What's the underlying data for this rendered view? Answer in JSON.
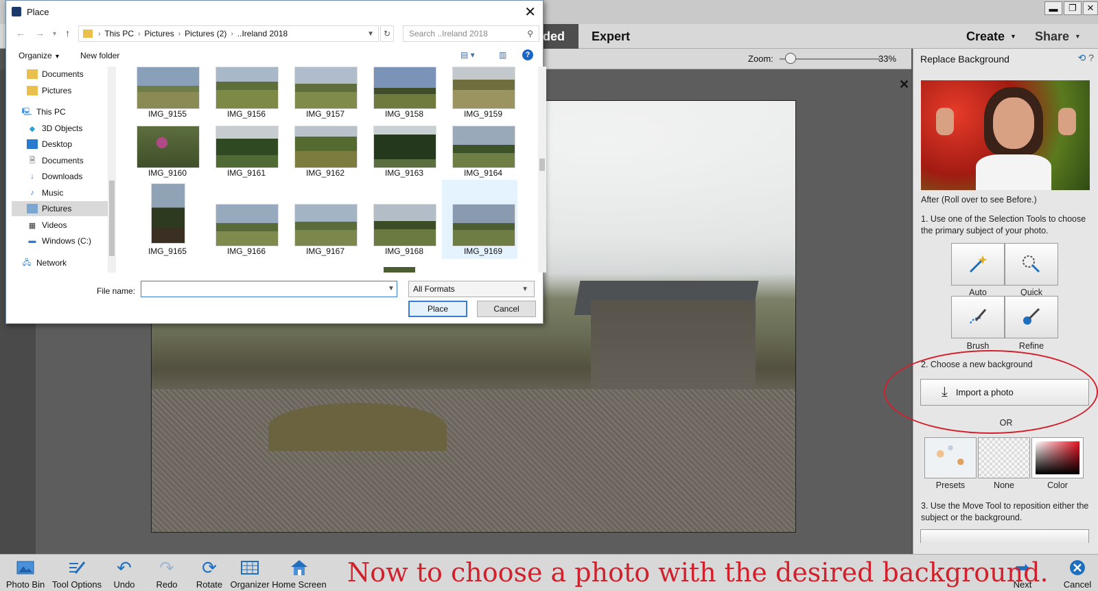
{
  "window_controls": {
    "minimize": "▬",
    "restore": "❐",
    "close": "✕"
  },
  "header": {
    "mode_guided": "ided",
    "mode_expert": "Expert",
    "create_label": "Create",
    "share_label": "Share"
  },
  "zoom": {
    "label": "Zoom:",
    "value": "33%",
    "level_fraction": 0.1
  },
  "right_panel": {
    "title": "Replace Background",
    "after_caption": "After (Roll over to see Before.)",
    "step1": "1. Use one of the Selection Tools to choose the primary subject of your photo.",
    "tools": [
      {
        "label": "Auto",
        "icon": "magic-wand-icon"
      },
      {
        "label": "Quick",
        "icon": "quick-selection-icon"
      },
      {
        "label": "Brush",
        "icon": "brush-icon"
      },
      {
        "label": "Refine",
        "icon": "refine-brush-icon"
      }
    ],
    "step2": "2. Choose a new background",
    "import_label": "Import a photo",
    "or_label": "OR",
    "backgrounds": [
      {
        "label": "Presets"
      },
      {
        "label": "None"
      },
      {
        "label": "Color"
      }
    ],
    "step3": "3. Use the Move Tool to reposition either the subject or the background."
  },
  "bottom_bar": {
    "items": [
      {
        "label": "Photo Bin",
        "icon": "photo-bin-icon"
      },
      {
        "label": "Tool Options",
        "icon": "tool-options-icon"
      },
      {
        "label": "Undo",
        "icon": "undo-icon"
      },
      {
        "label": "Redo",
        "icon": "redo-icon"
      },
      {
        "label": "Rotate",
        "icon": "rotate-icon"
      },
      {
        "label": "Organizer",
        "icon": "organizer-icon"
      },
      {
        "label": "Home Screen",
        "icon": "home-icon"
      },
      {
        "label": "Next",
        "icon": "next-arrow-icon"
      },
      {
        "label": "Cancel",
        "icon": "cancel-icon"
      }
    ]
  },
  "caption": "Now to choose a photo with the desired background.",
  "dialog": {
    "title": "Place",
    "breadcrumbs": [
      "This PC",
      "Pictures",
      "Pictures (2)",
      "..Ireland 2018"
    ],
    "search_placeholder": "Search ..Ireland 2018",
    "organize_label": "Organize",
    "new_folder_label": "New folder",
    "nav_items": [
      {
        "label": "Documents",
        "icon": "folder-icon"
      },
      {
        "label": "Pictures",
        "icon": "folder-icon"
      },
      {
        "label": "This PC",
        "icon": "computer-icon"
      },
      {
        "label": "3D Objects",
        "icon": "cube-icon"
      },
      {
        "label": "Desktop",
        "icon": "desktop-icon"
      },
      {
        "label": "Documents",
        "icon": "documents-icon"
      },
      {
        "label": "Downloads",
        "icon": "download-icon"
      },
      {
        "label": "Music",
        "icon": "music-icon"
      },
      {
        "label": "Pictures",
        "icon": "pictures-icon"
      },
      {
        "label": "Videos",
        "icon": "video-icon"
      },
      {
        "label": "Windows (C:)",
        "icon": "drive-icon"
      },
      {
        "label": "Network",
        "icon": "network-icon"
      }
    ],
    "files": [
      "IMG_9155",
      "IMG_9156",
      "IMG_9157",
      "IMG_9158",
      "IMG_9159",
      "IMG_9160",
      "IMG_9161",
      "IMG_9162",
      "IMG_9163",
      "IMG_9164",
      "IMG_9165",
      "IMG_9166",
      "IMG_9167",
      "IMG_9168",
      "IMG_9169"
    ],
    "filename_label": "File name:",
    "filename_value": "",
    "format_value": "All Formats",
    "place_label": "Place",
    "cancel_label": "Cancel"
  }
}
